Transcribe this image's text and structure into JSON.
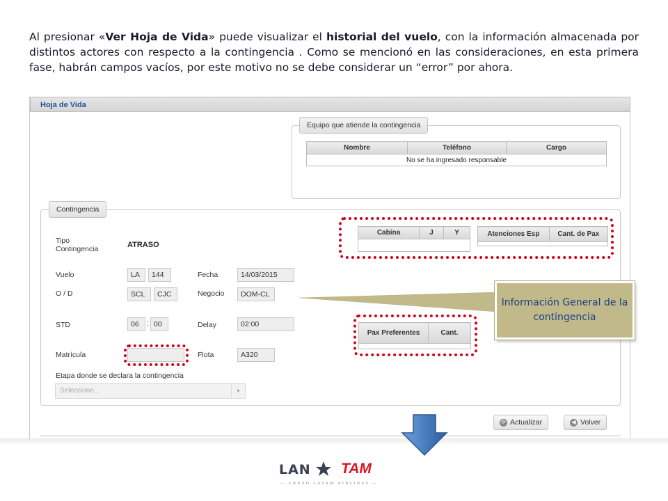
{
  "intro": {
    "p1": "Al presionar «",
    "b1": "Ver Hoja de Vida",
    "p2": "» puede visualizar el ",
    "b2": "historial del vuelo",
    "p3": ", con la información almacenada por distintos actores con respecto a la contingencia . Como se mencionó en las consideraciones, en esta primera fase, habrán campos vacíos, por este motivo no se debe considerar un “error” por ahora."
  },
  "panel": {
    "title": "Hoja de Vida"
  },
  "equipo": {
    "legend": "Equipo que atiende la contingencia",
    "columns": [
      "Nombre",
      "Teléfono",
      "Cargo"
    ],
    "empty_text": "No se ha ingresado responsable"
  },
  "contingencia": {
    "legend": "Contingencia",
    "tipo_label": "Tipo Contingencia",
    "tipo_value": "ATRASO",
    "vuelo_label": "Vuelo",
    "vuelo_carrier": "LA",
    "vuelo_number": "144",
    "fecha_label": "Fecha",
    "fecha_value": "14/03/2015",
    "od_label": "O / D",
    "origin": "SCL",
    "destination": "CJC",
    "negocio_label": "Negocio",
    "negocio_value": "DOM-CL",
    "std_label": "STD",
    "std_hour": "06",
    "std_sep": ":",
    "std_min": "00",
    "delay_label": "Delay",
    "delay_value": "02:00",
    "matricula_label": "Matrícula",
    "matricula_value": "",
    "flota_label": "Flota",
    "flota_value": "A320",
    "etapa_label": "Etapa donde se declara la contingencia",
    "etapa_placeholder": "Seleccione..."
  },
  "cabina_table": {
    "columns": [
      "Cabina",
      "J",
      "Y"
    ]
  },
  "atenciones_table": {
    "columns": [
      "Atenciones Esp",
      "Cant. de Pax"
    ]
  },
  "pax_table": {
    "columns": [
      "Pax Preferentes",
      "Cant."
    ]
  },
  "callout": {
    "text": "Información General de la contingencia"
  },
  "buttons": {
    "actualizar": "Actualizar",
    "volver": "Volver"
  },
  "logo": {
    "lan": "LAN",
    "tam": "TAM",
    "sub": "— GRUPO LATAM AIRLINES —"
  },
  "colors": {
    "highlight": "#d0021b",
    "callout_bg": "#c2b98a",
    "callout_text": "#1a3f82",
    "arrow": "#4a7fc0",
    "header_text": "#1f4e9a"
  }
}
